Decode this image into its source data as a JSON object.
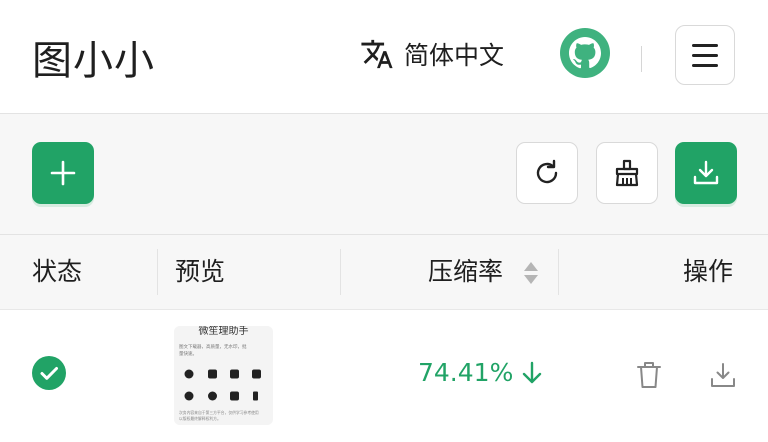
{
  "app": {
    "title": "图小小"
  },
  "header": {
    "language_label": "简体中文"
  },
  "table": {
    "columns": {
      "status": "状态",
      "preview": "预览",
      "ratio": "压缩率",
      "actions": "操作"
    },
    "rows": [
      {
        "status": "done",
        "compression_ratio": "74.41%",
        "preview": {
          "title": "微笙理助手",
          "line1": "图文下载器，高质量，无水印，批",
          "line2": "量快速。",
          "footer1": "次务内容来自于第三方平台，仅供学习参考使用",
          "footer2": "以版权最终解释权利方。"
        }
      }
    ]
  },
  "colors": {
    "accent": "#21a366",
    "border": "#d9d9d9",
    "toolbar_bg": "#f7f7f7"
  }
}
